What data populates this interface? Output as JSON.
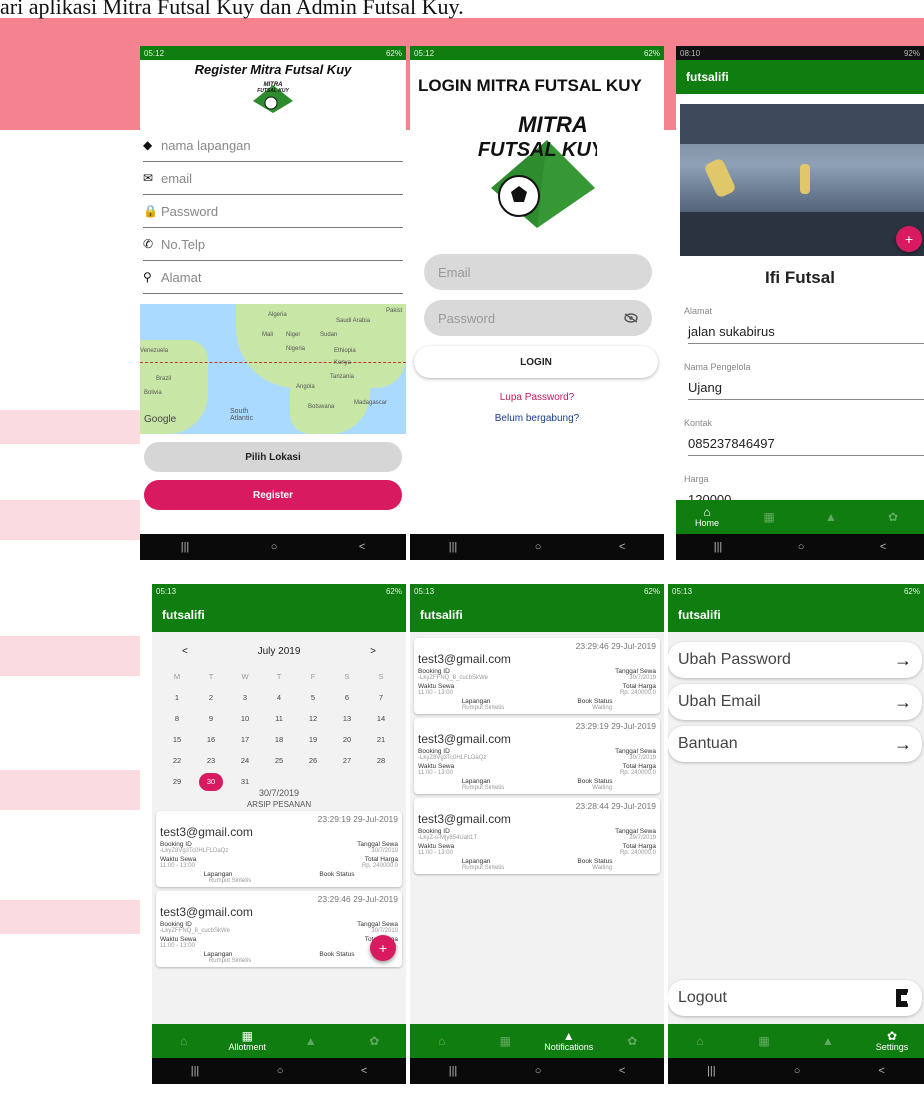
{
  "caption": "ari aplikasi Mitra Futsal Kuy dan Admin Futsal Kuy.",
  "colors": {
    "primary_green": "#0f7d0f",
    "accent_pink": "#d81b60",
    "banner_pink": "#f5828f"
  },
  "status": {
    "p1": {
      "time": "05:12",
      "right": "62%"
    },
    "p2": {
      "time": "05:12",
      "right": "62%"
    },
    "p3": {
      "time": "08:10",
      "right": "92%"
    },
    "p4": {
      "time": "05:13",
      "right": "62%"
    },
    "p5": {
      "time": "05:13",
      "right": "62%"
    },
    "p6": {
      "time": "05:13",
      "right": "62%"
    }
  },
  "nav": {
    "recents": "|||",
    "home": "○",
    "back": "<"
  },
  "logo": {
    "line1": "MITRA",
    "line2": "FUTSAL KUY"
  },
  "register": {
    "title": "Register Mitra Futsal Kuy",
    "fields": [
      {
        "icon": "diamond-icon",
        "glyph": "◆",
        "placeholder": "nama lapangan"
      },
      {
        "icon": "mail-icon",
        "glyph": "✉",
        "placeholder": "email"
      },
      {
        "icon": "lock-icon",
        "glyph": "🔒",
        "placeholder": "Password"
      },
      {
        "icon": "phone-icon",
        "glyph": "✆",
        "placeholder": "No.Telp"
      },
      {
        "icon": "pin-icon",
        "glyph": "⚲",
        "placeholder": "Alamat"
      }
    ],
    "map_labels": {
      "google": "Google",
      "south_atlantic": "South Atlantic",
      "algeria": "Algeria",
      "mali": "Mali",
      "niger": "Niger",
      "sudan": "Sudan",
      "nigeria": "Nigeria",
      "ethiopia": "Ethiopia",
      "kenya": "Kenya",
      "tanzania": "Tanzania",
      "angola": "Angola",
      "brazil": "Brazil",
      "bolivia": "Bolivia",
      "botswana": "Botswana",
      "madagascar": "Madagascar",
      "saudi": "Saudi Arabia",
      "venezuela": "Venezuela",
      "pakistan": "Pakist"
    },
    "pick_location": "Pilih Lokasi",
    "register_button": "Register"
  },
  "login": {
    "title": "LOGIN MITRA FUTSAL KUY",
    "email_placeholder": "Email",
    "password_placeholder": "Password",
    "login_button": "LOGIN",
    "forgot": "Lupa Password?",
    "join": "Belum bergabung?"
  },
  "detail": {
    "appbar": "futsalifi",
    "name": "Ifi Futsal",
    "fields": [
      {
        "label": "Alamat",
        "value": "jalan sukabirus"
      },
      {
        "label": "Nama Pengelola",
        "value": "Ujang"
      },
      {
        "label": "Kontak",
        "value": "085237846497"
      },
      {
        "label": "Harga",
        "value": "120000"
      }
    ],
    "nav_home": "Home"
  },
  "calendar": {
    "appbar": "futsalifi",
    "month": "July 2019",
    "prev": "<",
    "next": ">",
    "dow": [
      "M",
      "T",
      "W",
      "T",
      "F",
      "S",
      "S"
    ],
    "weeks": [
      [
        "1",
        "2",
        "3",
        "4",
        "5",
        "6",
        "7"
      ],
      [
        "8",
        "9",
        "10",
        "11",
        "12",
        "13",
        "14"
      ],
      [
        "15",
        "16",
        "17",
        "18",
        "19",
        "20",
        "21"
      ],
      [
        "22",
        "23",
        "24",
        "25",
        "26",
        "27",
        "28"
      ],
      [
        "29",
        "30",
        "31",
        "",
        "",
        "",
        ""
      ]
    ],
    "selected_day": "30",
    "selected_date": "30/7/2019",
    "archive": "ARSIP PESANAN",
    "nav_label": "Allotment"
  },
  "labels": {
    "booking_id": "Booking ID",
    "tanggal_sewa": "Tanggal Sewa",
    "waktu_sewa": "Waktu Sewa",
    "total_harga": "Total Harga",
    "lapangan": "Lapangan",
    "book_status": "Book Status"
  },
  "archive_cards": [
    {
      "timestamp": "23:29:19 29-Jul-2019",
      "email": "test3@gmail.com",
      "booking_id": "-LkyZ8Vg3Tc0HLFLDaQz",
      "date": "30/7/2019",
      "time": "11:00 - 13:00",
      "price": "Rp. 240000.0",
      "field": "Rumput Sintetis",
      "status": ""
    },
    {
      "timestamp": "23:29:46 29-Jul-2019",
      "email": "test3@gmail.com",
      "booking_id": "-LkyZFFNQ_8_cucbSkWe",
      "date": "30/7/2019",
      "time": "11:00 - 13:00",
      "price": "Rp.",
      "field": "Rumput Sintetis",
      "status": ""
    }
  ],
  "notifications": {
    "appbar": "futsalifi",
    "nav_label": "Notifications",
    "cards": [
      {
        "timestamp": "23:29:46 29-Jul-2019",
        "email": "test3@gmail.com",
        "booking_id": "-LkyZFFNQ_8_cucbSkWe",
        "date": "30/7/2019",
        "time": "11:00 - 13:00",
        "price": "Rp. 240000.0",
        "field": "Rumput Sintetis",
        "status": "Waiting"
      },
      {
        "timestamp": "23:29:19 29-Jul-2019",
        "email": "test3@gmail.com",
        "booking_id": "-LkyZ8Vg3Tc0HLFLDaQz",
        "date": "30/7/2019",
        "time": "11:00 - 13:00",
        "price": "Rp. 240000.0",
        "field": "Rumput Sintetis",
        "status": "Waiting"
      },
      {
        "timestamp": "23:28:44 29-Jul-2019",
        "email": "test3@gmail.com",
        "booking_id": "-LkyZ-s-Mjy854Ualt1T",
        "date": "29/7/2019",
        "time": "11:00 - 13:00",
        "price": "Rp. 240000.0",
        "field": "Rumput Sintetis",
        "status": "Waiting"
      }
    ]
  },
  "settings": {
    "appbar": "futsalifi",
    "items": [
      "Ubah Password",
      "Ubah Email",
      "Bantuan"
    ],
    "arrow": "→",
    "logout": "Logout",
    "nav_label": "Settings"
  }
}
